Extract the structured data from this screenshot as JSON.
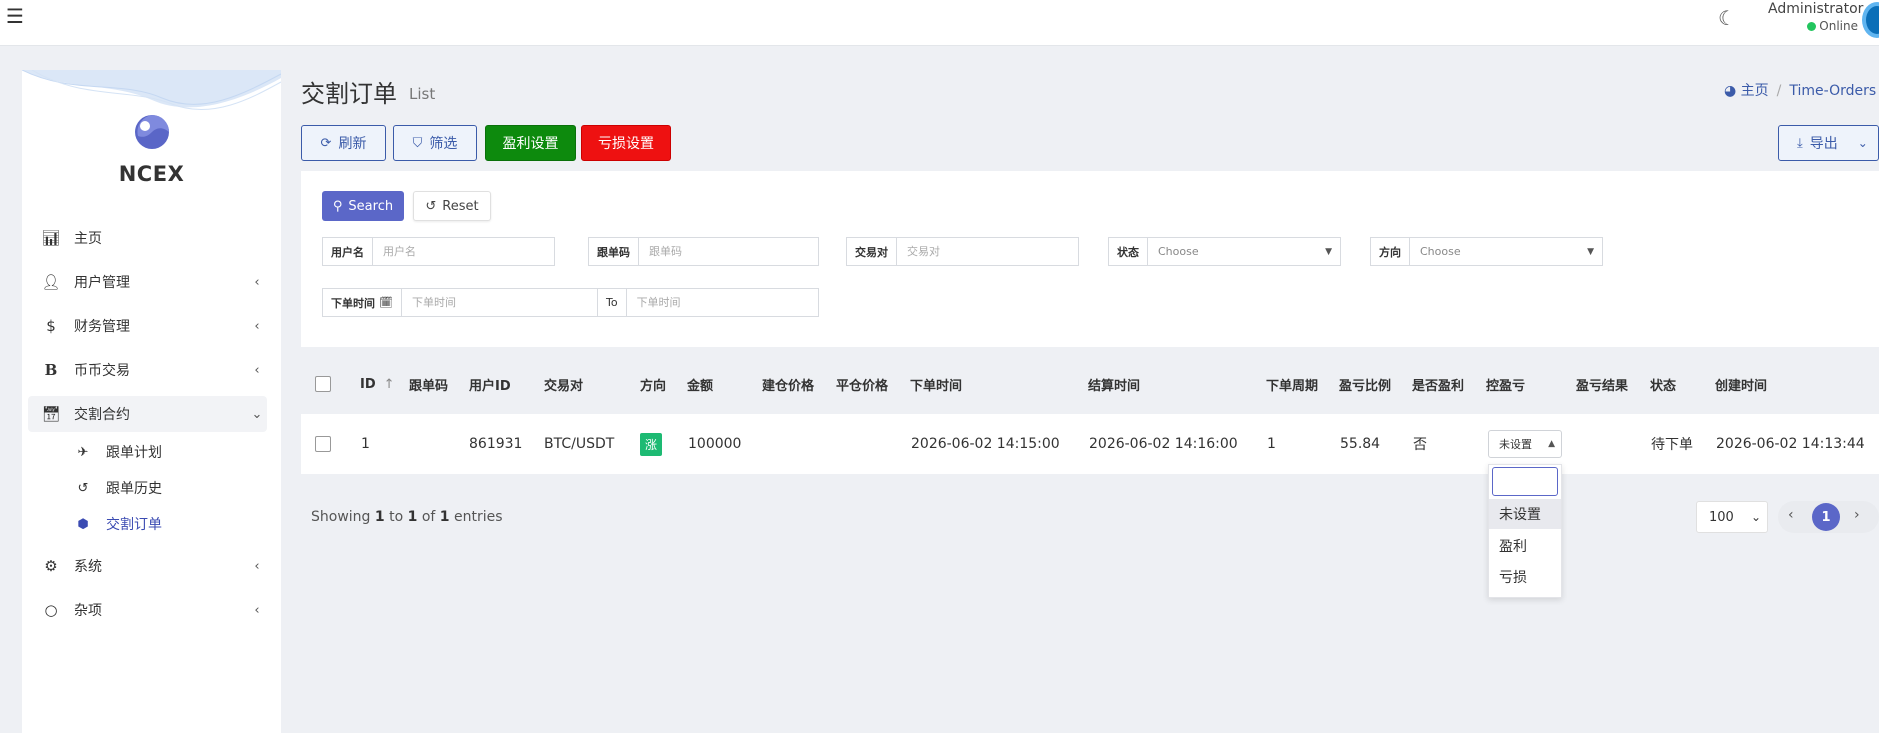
{
  "topbar": {
    "user_name": "Administrator",
    "user_status": "Online"
  },
  "sidebar": {
    "brand": "NCEX",
    "items": [
      {
        "label": "主页",
        "icon": "bar-chart-icon"
      },
      {
        "label": "用户管理",
        "icon": "users-icon"
      },
      {
        "label": "财务管理",
        "icon": "dollar-icon"
      },
      {
        "label": "币币交易",
        "icon": "bitcoin-icon"
      },
      {
        "label": "交割合约",
        "icon": "calendar-icon"
      },
      {
        "label": "系统",
        "icon": "gear-icon"
      },
      {
        "label": "杂项",
        "icon": "circle-icon"
      }
    ],
    "subitems": [
      {
        "label": "跟单计划",
        "icon": "plane-icon"
      },
      {
        "label": "跟单历史",
        "icon": "history-icon"
      },
      {
        "label": "交割订单",
        "icon": "hexagon-icon"
      }
    ]
  },
  "header": {
    "title": "交割订单",
    "subtitle": "List",
    "breadcrumb_home": "主页",
    "breadcrumb_current": "Time-Orders"
  },
  "toolbar": {
    "refresh": "刷新",
    "filter": "筛选",
    "profit_setting": "盈利设置",
    "loss_setting": "亏损设置",
    "export": "导出"
  },
  "filters": {
    "search": "Search",
    "reset": "Reset",
    "username_label": "用户名",
    "username_placeholder": "用户名",
    "follow_code_label": "跟单码",
    "follow_code_placeholder": "跟单码",
    "pair_label": "交易对",
    "pair_placeholder": "交易对",
    "status_label": "状态",
    "status_value": "Choose",
    "direction_label": "方向",
    "direction_value": "Choose",
    "order_time_label": "下单时间",
    "order_time_placeholder_start": "下单时间",
    "to_label": "To",
    "order_time_placeholder_end": "下单时间"
  },
  "table": {
    "columns": [
      "ID",
      "跟单码",
      "用户ID",
      "交易对",
      "方向",
      "金额",
      "建仓价格",
      "平仓价格",
      "下单时间",
      "结算时间",
      "下单周期",
      "盈亏比例",
      "是否盈利",
      "控盈亏",
      "盈亏结果",
      "状态",
      "创建时间"
    ],
    "rows": [
      {
        "id": "1",
        "follow_code": "",
        "user_id": "861931",
        "pair": "BTC/USDT",
        "direction": "涨",
        "amount": "100000",
        "open_price": "",
        "close_price": "",
        "order_time": "2026-06-02 14:15:00",
        "settle_time": "2026-06-02 14:16:00",
        "period": "1",
        "ratio": "55.84",
        "is_profit": "否",
        "control": "未设置",
        "result": "",
        "status": "待下单",
        "created": "2026-06-02 14:13:44"
      }
    ]
  },
  "control_dropdown": {
    "options": [
      "未设置",
      "盈利",
      "亏损"
    ],
    "selected": "未设置"
  },
  "footer": {
    "showing_prefix": "Showing",
    "from": "1",
    "to_word": "to",
    "to": "1",
    "of_word": "of",
    "total": "1",
    "entries_word": "entries",
    "page_size": "100",
    "current_page": "1"
  },
  "colors": {
    "accent": "#5b67c8",
    "green": "#0d8a0d",
    "red": "#ee1111",
    "up_badge": "#1dba73",
    "online": "#22c55e"
  }
}
